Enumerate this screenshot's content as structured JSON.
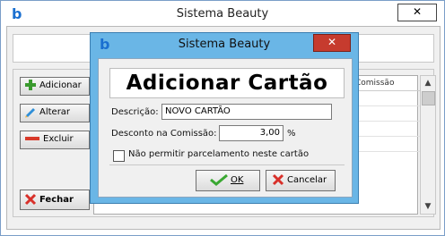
{
  "main_window": {
    "logo": "b",
    "title": "Sistema Beauty",
    "close_glyph": "✕"
  },
  "toolbar": {
    "add_label": "Adicionar",
    "edit_label": "Alterar",
    "delete_label": "Excluir",
    "close_label": "Fechar"
  },
  "grid": {
    "column_header": "Comissão"
  },
  "dialog": {
    "logo": "b",
    "title": "Sistema Beauty",
    "close_glyph": "✕",
    "heading": "Adicionar Cartão",
    "description_label": "Descrição:",
    "description_value": "NOVO CARTÃO",
    "discount_label": "Desconto na Comissão:",
    "discount_value": "3,00",
    "percent_sign": "%",
    "checkbox_label": "Não permitir parcelamento neste cartão",
    "checkbox_checked": false,
    "ok_label": "OK",
    "cancel_label": "Cancelar"
  },
  "colors": {
    "dialog_frame": "#6ab6e6",
    "close_red": "#c63b2e",
    "logo_blue": "#1a6fd0"
  }
}
